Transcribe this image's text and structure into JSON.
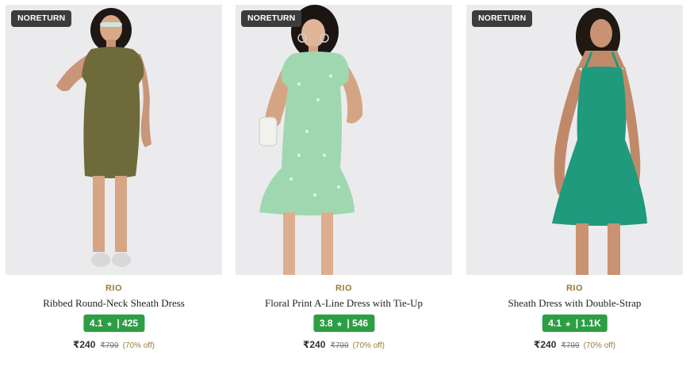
{
  "products": [
    {
      "badge": "NORETURN",
      "brand": "RIO",
      "name": "Ribbed Round-Neck Sheath Dress",
      "rating": "4.1",
      "reviews": "425",
      "price": "₹240",
      "mrp": "₹799",
      "discount": "(70% off)",
      "dress_color": "#6f6a3a"
    },
    {
      "badge": "NORETURN",
      "brand": "RIO",
      "name": "Floral Print A-Line Dress with Tie-Up",
      "rating": "3.8",
      "reviews": "546",
      "price": "₹240",
      "mrp": "₹799",
      "discount": "(70% off)",
      "dress_color": "#9fd8b0"
    },
    {
      "badge": "NORETURN",
      "brand": "RIO",
      "name": "Sheath Dress with Double-Strap",
      "rating": "4.1",
      "reviews": "1.1K",
      "price": "₹240",
      "mrp": "₹799",
      "discount": "(70% off)",
      "dress_color": "#1f9a7c"
    }
  ],
  "theme": {
    "rating_bg": "#2e9e45",
    "brand_color": "#9a7a3a",
    "badge_bg": "#3c3c3c"
  }
}
